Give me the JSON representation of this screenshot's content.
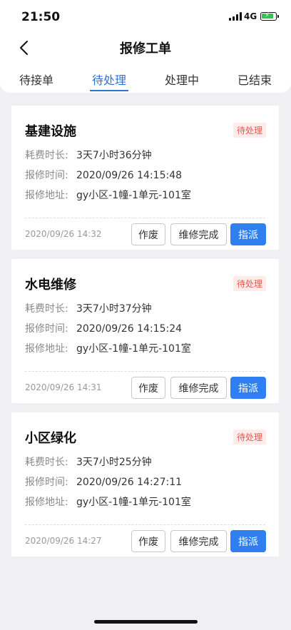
{
  "status_bar": {
    "time": "21:50",
    "network": "4G"
  },
  "nav": {
    "title": "报修工单"
  },
  "tabs": [
    {
      "label": "待接单",
      "active": false
    },
    {
      "label": "待处理",
      "active": true
    },
    {
      "label": "处理中",
      "active": false
    },
    {
      "label": "已结束",
      "active": false
    }
  ],
  "labels": {
    "duration": "耗费时长:",
    "report_time": "报修时间:",
    "address": "报修地址:"
  },
  "buttons": {
    "void": "作废",
    "done": "维修完成",
    "assign": "指派"
  },
  "orders": [
    {
      "title": "基建设施",
      "status": "待处理",
      "duration": "3天7小时36分钟",
      "report_time": "2020/09/26 14:15:48",
      "address": "gy小区-1幢-1单元-101室",
      "created": "2020/09/26 14:32"
    },
    {
      "title": "水电维修",
      "status": "待处理",
      "duration": "3天7小时37分钟",
      "report_time": "2020/09/26 14:15:24",
      "address": "gy小区-1幢-1单元-101室",
      "created": "2020/09/26 14:31"
    },
    {
      "title": "小区绿化",
      "status": "待处理",
      "duration": "3天7小时25分钟",
      "report_time": "2020/09/26 14:27:11",
      "address": "gy小区-1幢-1单元-101室",
      "created": "2020/09/26 14:27"
    }
  ]
}
